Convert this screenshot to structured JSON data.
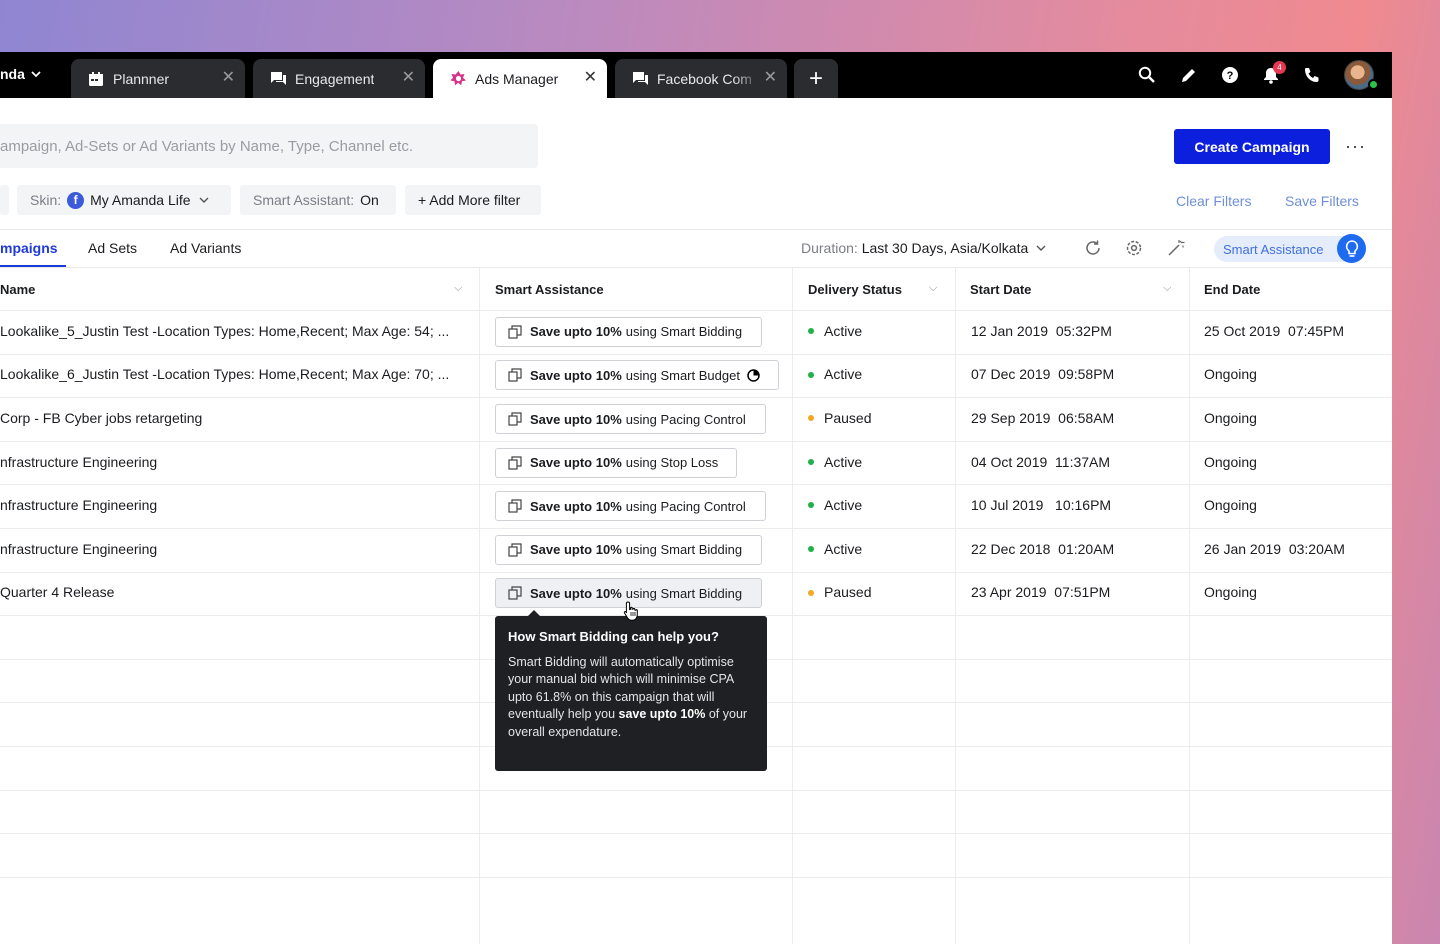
{
  "topbar": {
    "account_label": "nda",
    "tabs": [
      {
        "label": "Plannner",
        "icon": "calendar-icon"
      },
      {
        "label": "Engagement",
        "icon": "chat-icon"
      },
      {
        "label": "Ads Manager",
        "icon": "ads-icon"
      },
      {
        "label": "Facebook Com",
        "icon": "chat-icon"
      }
    ],
    "add_tab_label": "+",
    "notification_count": "4"
  },
  "toolbar": {
    "search_placeholder": "ampaign, Ad-Sets or Ad Variants by Name, Type, Channel etc.",
    "create_button": "Create Campaign",
    "more_label": "···"
  },
  "filters": {
    "skin_label": "Skin:",
    "skin_fb": "f",
    "skin_value": "My Amanda Life",
    "smart_assistant_label": "Smart Assistant:",
    "smart_assistant_value": "On",
    "add_filter": "+ Add More filter",
    "clear": "Clear Filters",
    "save": "Save Filters"
  },
  "subtabs": [
    {
      "label": "mpaigns",
      "active": true
    },
    {
      "label": "Ad Sets",
      "active": false
    },
    {
      "label": "Ad Variants",
      "active": false
    }
  ],
  "duration": {
    "label": "Duration:",
    "value": "Last 30 Days, Asia/Kolkata"
  },
  "smart_assistance_pill": "Smart Assistance",
  "table": {
    "columns": [
      "Name",
      "Smart Assistance",
      "Delivery Status",
      "Start Date",
      "End Date"
    ],
    "rows": [
      {
        "name": "Lookalike_5_Justin Test -Location Types: Home,Recent; Max Age: 54; ...",
        "sa_prefix": "Save upto 10%",
        "sa_suffix": "using Smart Bidding",
        "status": "Active",
        "start": "12 Jan 2019  05:32PM",
        "end": "25 Oct 2019  07:45PM"
      },
      {
        "name": "Lookalike_6_Justin Test -Location Types: Home,Recent; Max Age: 70; ...",
        "sa_prefix": "Save upto 10%",
        "sa_suffix": "using Smart Budget",
        "status": "Active",
        "start": "07 Dec 2019  09:58PM",
        "end": "Ongoing"
      },
      {
        "name": "Corp - FB Cyber jobs retargeting",
        "sa_prefix": "Save upto 10%",
        "sa_suffix": "using Pacing Control",
        "status": "Paused",
        "start": "29 Sep 2019  06:58AM",
        "end": "Ongoing"
      },
      {
        "name": "nfrastructure Engineering",
        "sa_prefix": "Save upto 10%",
        "sa_suffix": "using Stop Loss",
        "status": "Active",
        "start": "04 Oct 2019  11:37AM",
        "end": "Ongoing"
      },
      {
        "name": "nfrastructure Engineering",
        "sa_prefix": "Save upto 10%",
        "sa_suffix": "using Pacing Control",
        "status": "Active",
        "start": "10 Jul 2019   10:16PM",
        "end": "Ongoing"
      },
      {
        "name": "nfrastructure Engineering",
        "sa_prefix": "Save upto 10%",
        "sa_suffix": "using Smart Bidding",
        "status": "Active",
        "start": "22 Dec 2018  01:20AM",
        "end": "26 Jan 2019  03:20AM"
      },
      {
        "name": "Quarter 4 Release",
        "sa_prefix": "Save upto 10%",
        "sa_suffix": "using Smart Bidding",
        "status": "Paused",
        "start": "23 Apr 2019  07:51PM",
        "end": "Ongoing"
      }
    ]
  },
  "tooltip": {
    "title": "How Smart Bidding can help you?",
    "body_1": "Smart Bidding will automatically optimise your manual bid which will minimise CPA upto 61.8% on this campaign that will eventually help you",
    "body_bold": "save upto 10%",
    "body_2": "of your overall expendature."
  },
  "colors": {
    "accent": "#0b1fdc",
    "active": "#1fb14a",
    "paused": "#f5a623",
    "link": "#6f8fd8"
  }
}
